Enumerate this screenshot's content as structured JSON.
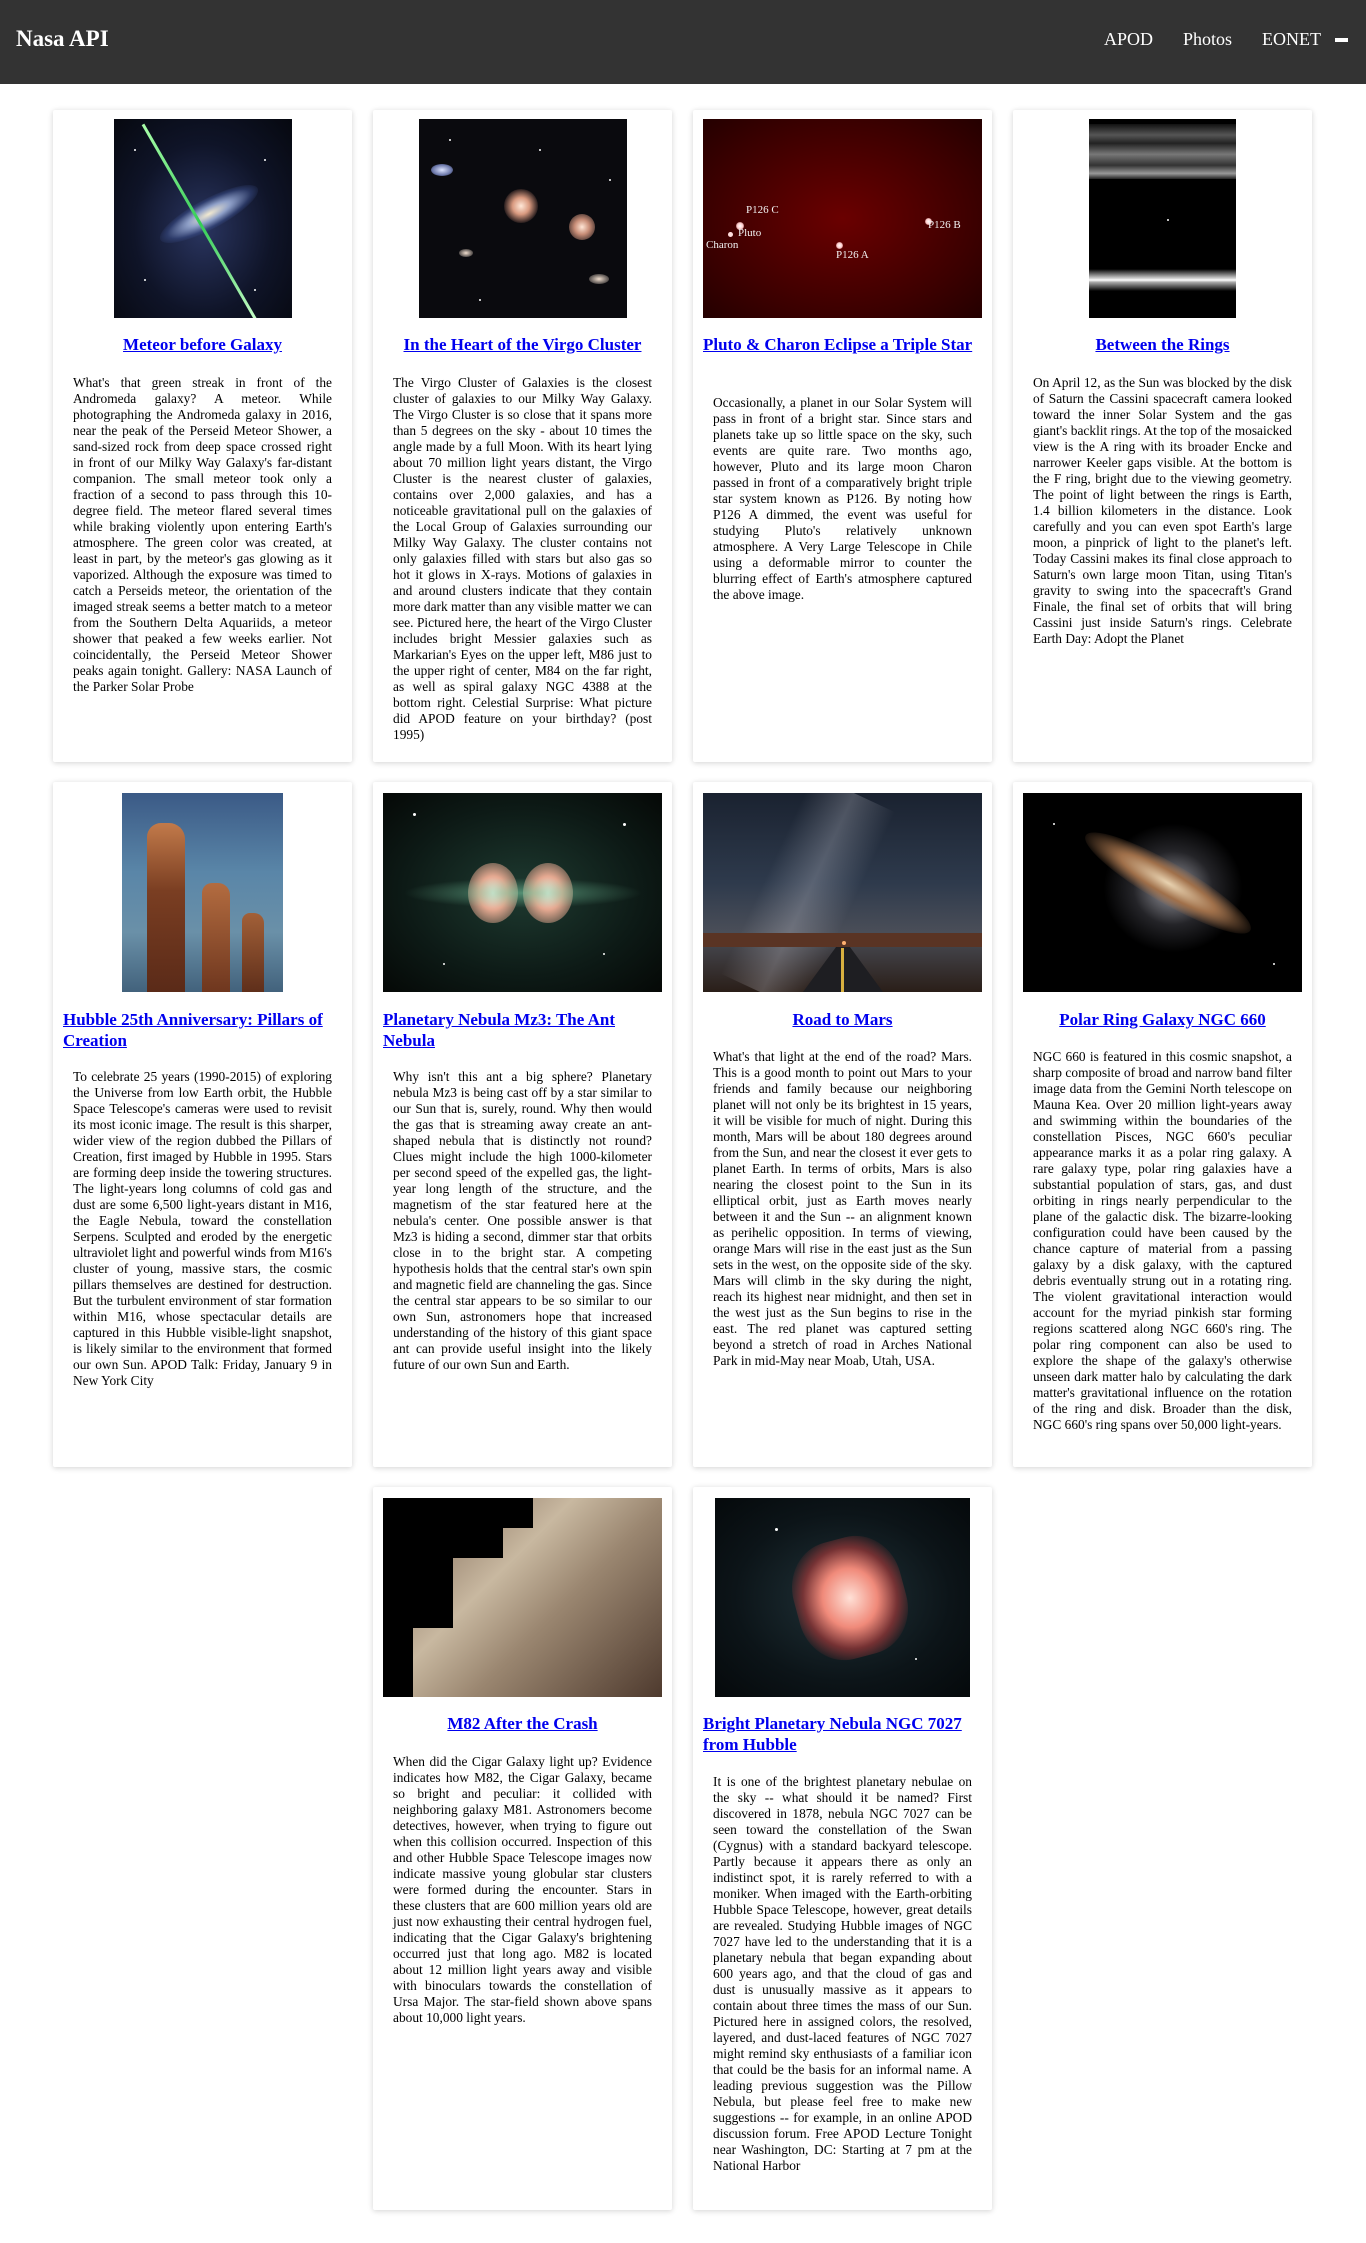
{
  "app": {
    "brand": "Nasa API",
    "nav": [
      "APOD",
      "Photos",
      "EONET"
    ]
  },
  "cards": [
    {
      "title": "Meteor before Galaxy",
      "description": "What's that green streak in front of the Andromeda galaxy? A meteor. While photographing the Andromeda galaxy in 2016, near the peak of the Perseid Meteor Shower, a sand-sized rock from deep space crossed right in front of our Milky Way Galaxy's far-distant companion. The small meteor took only a fraction of a second to pass through this 10-degree field. The meteor flared several times while braking violently upon entering Earth's atmosphere. The green color was created, at least in part, by the meteor's gas glowing as it vaporized. Although the exposure was timed to catch a Perseids meteor, the orientation of the imaged streak seems a better match to a meteor from the Southern Delta Aquariids, a meteor shower that peaked a few weeks earlier. Not coincidentally, the Perseid Meteor Shower peaks again tonight. Gallery: NASA Launch of the Parker Solar Probe"
    },
    {
      "title": "In the Heart of the Virgo Cluster",
      "description": "The Virgo Cluster of Galaxies is the closest cluster of galaxies to our Milky Way Galaxy. The Virgo Cluster is so close that it spans more than 5 degrees on the sky - about 10 times the angle made by a full Moon. With its heart lying about 70 million light years distant, the Virgo Cluster is the nearest cluster of galaxies, contains over 2,000 galaxies, and has a noticeable gravitational pull on the galaxies of the Local Group of Galaxies surrounding our Milky Way Galaxy. The cluster contains not only galaxies filled with stars but also gas so hot it glows in X-rays. Motions of galaxies in and around clusters indicate that they contain more dark matter than any visible matter we can see. Pictured here, the heart of the Virgo Cluster includes bright Messier galaxies such as Markarian's Eyes on the upper left, M86 just to the upper right of center, M84 on the far right, as well as spiral galaxy NGC 4388 at the bottom right. Celestial Surprise: What picture did APOD feature on your birthday? (post 1995)"
    },
    {
      "title": "Pluto & Charon Eclipse a Triple Star",
      "description": "Occasionally, a planet in our Solar System will pass in front of a bright star. Since stars and planets take up so little space on the sky, such events are quite rare. Two months ago, however, Pluto and its large moon Charon passed in front of a comparatively bright triple star system known as P126. By noting how P126 A dimmed, the event was useful for studying Pluto's relatively unknown atmosphere. A Very Large Telescope in Chile using a deformable mirror to counter the blurring effect of Earth's atmosphere captured the above image.",
      "image_labels": [
        "P126 C",
        "Pluto",
        "Charon",
        "P126 B",
        "P126 A"
      ]
    },
    {
      "title": "Between the Rings",
      "description": "On April 12, as the Sun was blocked by the disk of Saturn the Cassini spacecraft camera looked toward the inner Solar System and the gas giant's backlit rings. At the top of the mosaicked view is the A ring with its broader Encke and narrower Keeler gaps visible. At the bottom is the F ring, bright due to the viewing geometry. The point of light between the rings is Earth, 1.4 billion kilometers in the distance. Look carefully and you can even spot Earth's large moon, a pinprick of light to the planet's left. Today Cassini makes its final close approach to Saturn's own large moon Titan, using Titan's gravity to swing into the spacecraft's Grand Finale, the final set of orbits that will bring Cassini just inside Saturn's rings. Celebrate Earth Day: Adopt the Planet"
    },
    {
      "title": "Hubble 25th Anniversary: Pillars of Creation",
      "description": "To celebrate 25 years (1990-2015) of exploring the Universe from low Earth orbit, the Hubble Space Telescope's cameras were used to revisit its most iconic image. The result is this sharper, wider view of the region dubbed the Pillars of Creation, first imaged by Hubble in 1995. Stars are forming deep inside the towering structures. The light-years long columns of cold gas and dust are some 6,500 light-years distant in M16, the Eagle Nebula, toward the constellation Serpens. Sculpted and eroded by the energetic ultraviolet light and powerful winds from M16's cluster of young, massive stars, the cosmic pillars themselves are destined for destruction. But the turbulent environment of star formation within M16, whose spectacular details are captured in this Hubble visible-light snapshot, is likely similar to the environment that formed our own Sun. APOD Talk: Friday, January 9 in New York City"
    },
    {
      "title": "Planetary Nebula Mz3: The Ant Nebula",
      "description": "Why isn't this ant a big sphere? Planetary nebula Mz3 is being cast off by a star similar to our Sun that is, surely, round. Why then would the gas that is streaming away create an ant-shaped nebula that is distinctly not round? Clues might include the high 1000-kilometer per second speed of the expelled gas, the light-year long length of the structure, and the magnetism of the star featured here at the nebula's center. One possible answer is that Mz3 is hiding a second, dimmer star that orbits close in to the bright star. A competing hypothesis holds that the central star's own spin and magnetic field are channeling the gas. Since the central star appears to be so similar to our own Sun, astronomers hope that increased understanding of the history of this giant space ant can provide useful insight into the likely future of our own Sun and Earth."
    },
    {
      "title": "Road to Mars",
      "description": "What's that light at the end of the road? Mars. This is a good month to point out Mars to your friends and family because our neighboring planet will not only be its brightest in 15 years, it will be visible for much of night. During this month, Mars will be about 180 degrees around from the Sun, and near the closest it ever gets to planet Earth. In terms of orbits, Mars is also nearing the closest point to the Sun in its elliptical orbit, just as Earth moves nearly between it and the Sun -- an alignment known as perihelic opposition. In terms of viewing, orange Mars will rise in the east just as the Sun sets in the west, on the opposite side of the sky. Mars will climb in the sky during the night, reach its highest near midnight, and then set in the west just as the Sun begins to rise in the east. The red planet was captured setting beyond a stretch of road in Arches National Park in mid-May near Moab, Utah, USA."
    },
    {
      "title": "Polar Ring Galaxy NGC 660",
      "description": "NGC 660 is featured in this cosmic snapshot, a sharp composite of broad and narrow band filter image data from the Gemini North telescope on Mauna Kea. Over 20 million light-years away and swimming within the boundaries of the constellation Pisces, NGC 660's peculiar appearance marks it as a polar ring galaxy. A rare galaxy type, polar ring galaxies have a substantial population of stars, gas, and dust orbiting in rings nearly perpendicular to the plane of the galactic disk. The bizarre-looking configuration could have been caused by the chance capture of material from a passing galaxy by a disk galaxy, with the captured debris eventually strung out in a rotating ring. The violent gravitational interaction would account for the myriad pinkish star forming regions scattered along NGC 660's ring. The polar ring component can also be used to explore the shape of the galaxy's otherwise unseen dark matter halo by calculating the dark matter's gravitational influence on the rotation of the ring and disk. Broader than the disk, NGC 660's ring spans over 50,000 light-years."
    },
    {
      "title": "M82 After the Crash",
      "description": "When did the Cigar Galaxy light up? Evidence indicates how M82, the Cigar Galaxy, became so bright and peculiar: it collided with neighboring galaxy M81. Astronomers become detectives, however, when trying to figure out when this collision occurred. Inspection of this and other Hubble Space Telescope images now indicate massive young globular star clusters were formed during the encounter. Stars in these clusters that are 600 million years old are just now exhausting their central hydrogen fuel, indicating that the Cigar Galaxy's brightening occurred just that long ago. M82 is located about 12 million light years away and visible with binoculars towards the constellation of Ursa Major. The star-field shown above spans about 10,000 light years."
    },
    {
      "title": "Bright Planetary Nebula NGC 7027 from Hubble",
      "description": "It is one of the brightest planetary nebulae on the sky -- what should it be named? First discovered in 1878, nebula NGC 7027 can be seen toward the constellation of the Swan (Cygnus) with a standard backyard telescope. Partly because it appears there as only an indistinct spot, it is rarely referred to with a moniker. When imaged with the Earth-orbiting Hubble Space Telescope, however, great details are revealed. Studying Hubble images of NGC 7027 have led to the understanding that it is a planetary nebula that began expanding about 600 years ago, and that the cloud of gas and dust is unusually massive as it appears to contain about three times the mass of our Sun. Pictured here in assigned colors, the resolved, layered, and dust-laced features of NGC 7027 might remind sky enthusiasts of a familiar icon that could be the basis for an informal name. A leading previous suggestion was the Pillow Nebula, but please feel free to make new suggestions -- for example, in an online APOD discussion forum. Free APOD Lecture Tonight near Washington, DC: Starting at 7 pm at the National Harbor"
    }
  ]
}
